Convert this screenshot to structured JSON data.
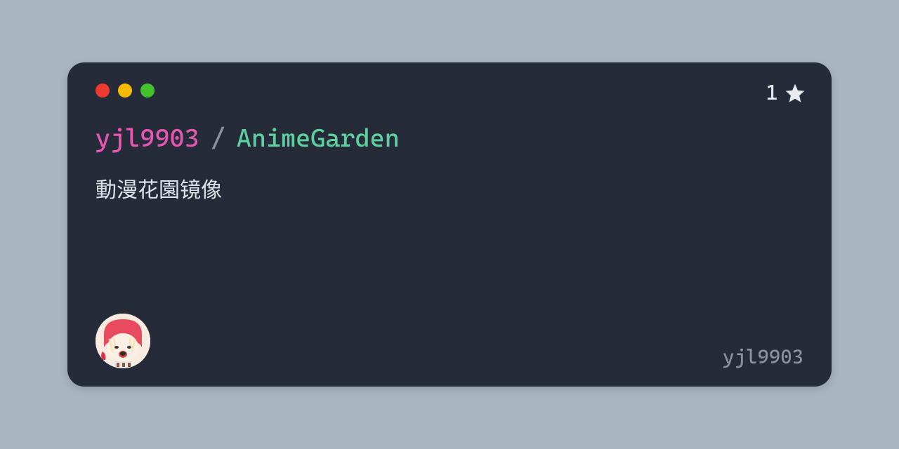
{
  "repo": {
    "owner": "yjl9903",
    "separator": "/",
    "name": "AnimeGarden",
    "description": "動漫花園镜像",
    "stars": "1",
    "username": "yjl9903"
  }
}
